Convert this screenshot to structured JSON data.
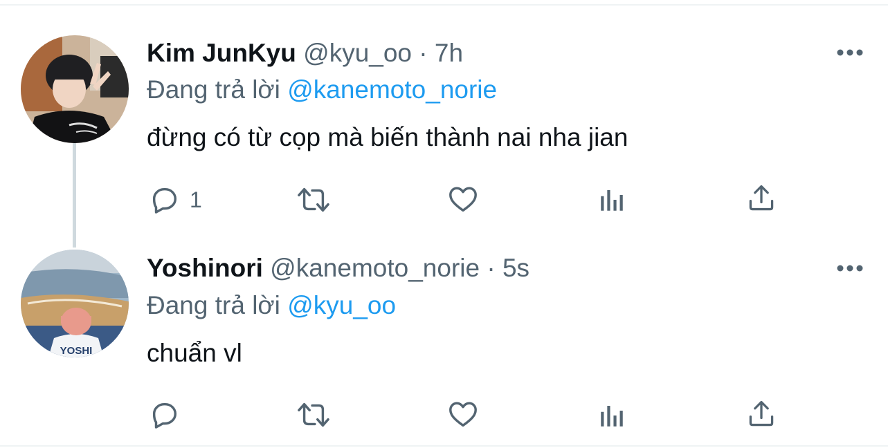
{
  "tweets": [
    {
      "display_name": "Kim JunKyu",
      "handle": "@kyu_oo",
      "dot": "·",
      "time": "7h",
      "replying_prefix": "Đang trả lời",
      "replying_to": "@kanemoto_norie",
      "text": "đừng có từ cọp mà biến thành nai nha jian",
      "reply_count": "1"
    },
    {
      "display_name": "Yoshinori",
      "handle": "@kanemoto_norie",
      "dot": "·",
      "time": "5s",
      "replying_prefix": "Đang trả lời",
      "replying_to": "@kyu_oo",
      "text": "chuẩn vl",
      "reply_count": "",
      "shirt_text": "YOSHI"
    }
  ],
  "colors": {
    "text": "#0f1419",
    "secondary": "#536471",
    "link": "#1d9bf0",
    "thread_line": "#cfd9de"
  },
  "icons": [
    "reply-icon",
    "retweet-icon",
    "like-icon",
    "analytics-icon",
    "share-icon",
    "more-icon"
  ]
}
